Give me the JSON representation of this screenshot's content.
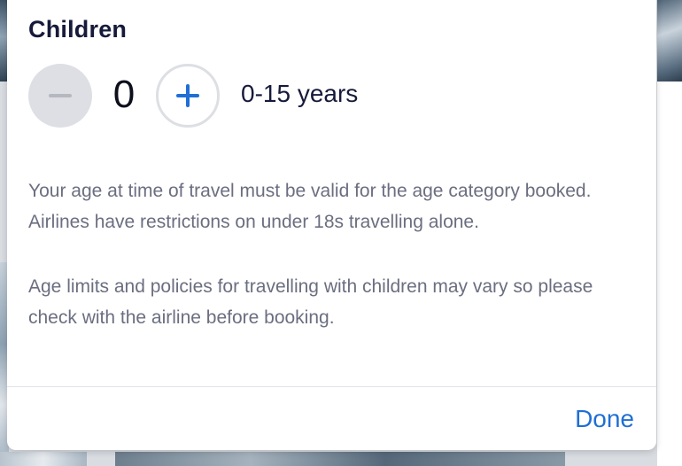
{
  "children": {
    "title": "Children",
    "count": "0",
    "age_range": "0-15 years",
    "decrement_icon": "minus-icon",
    "increment_icon": "plus-icon"
  },
  "info": {
    "paragraph_1": "Your age at time of travel must be valid for the age category booked. Airlines have restrictions on under 18s travelling alone.",
    "paragraph_2": "Age limits and policies for travelling with children may vary so please check with the airline before booking."
  },
  "footer": {
    "done_label": "Done"
  },
  "colors": {
    "accent": "#1f6fd4",
    "heading": "#161a3a",
    "body_text": "#6b6e80",
    "disabled_button": "#dddfe4"
  }
}
